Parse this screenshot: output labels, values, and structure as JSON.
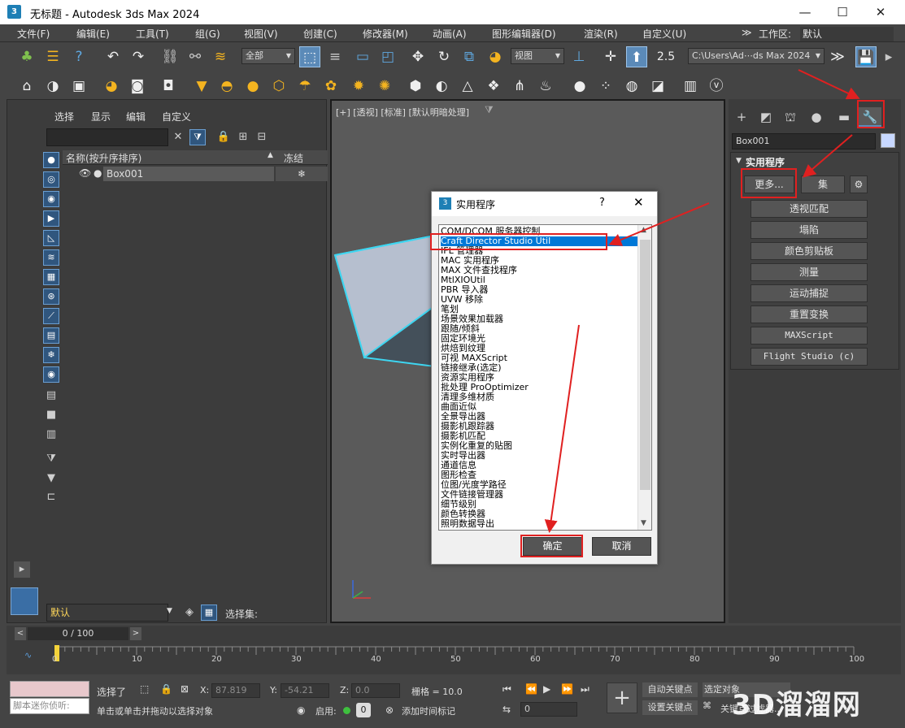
{
  "window": {
    "title": "无标题 - Autodesk 3ds Max 2024",
    "app_icon": "3"
  },
  "menus": [
    "文件(F)",
    "编辑(E)",
    "工具(T)",
    "组(G)",
    "视图(V)",
    "创建(C)",
    "修改器(M)",
    "动画(A)",
    "图形编辑器(D)",
    "渲染(R)",
    "自定义(U)"
  ],
  "workspace": {
    "label": "工作区:",
    "value": "默认"
  },
  "toolbar": {
    "filter_value": "全部",
    "refcoord_value": "视图",
    "path_value": "C:\\Users\\Ad⋯ds Max 2024",
    "snap_value": "2.5"
  },
  "scene_explorer": {
    "tabs": [
      "选择",
      "显示",
      "编辑",
      "自定义"
    ],
    "col_name": "名称(按升序排序)",
    "col_frozen": "冻结",
    "rows": [
      {
        "name": "Box001"
      }
    ],
    "layer_value": "默认",
    "selection_set_label": "选择集:"
  },
  "viewport": {
    "label": "[+] [透视] [标准] [默认明暗处理]"
  },
  "command_panel": {
    "object_name": "Box001",
    "rollout_title": "实用程序",
    "more_label": "更多...",
    "sets_label": "集",
    "utilities": [
      "透视匹配",
      "塌陷",
      "颜色剪贴板",
      "测量",
      "运动捕捉",
      "重置变换",
      "MAXScript",
      "Flight Studio (c)"
    ]
  },
  "dialog": {
    "title": "实用程序",
    "help": "?",
    "items": [
      "COM/DCOM 服务器控制",
      "Craft Director Studio Util",
      "IFL 管理器",
      "MAC 实用程序",
      "MAX 文件查找程序",
      "MtlXIOUtil",
      "PBR 导入器",
      "UVW 移除",
      "笔划",
      "场景效果加载器",
      "跟随/倾斜",
      "固定环境光",
      "烘焙到纹理",
      "可视 MAXScript",
      "链接继承(选定)",
      "资源实用程序",
      "批处理 ProOptimizer",
      "清理多维材质",
      "曲面近似",
      "全景导出器",
      "摄影机跟踪器",
      "摄影机匹配",
      "实例化重复的贴图",
      "实时导出器",
      "通道信息",
      "图形检查",
      "位图/光度学路径",
      "文件链接管理器",
      "细节级别",
      "颜色转换器",
      "照明数据导出"
    ],
    "selected_index": 1,
    "ok_label": "确定",
    "cancel_label": "取消"
  },
  "timeline": {
    "frame_display": "0 / 100",
    "ticks": [
      "0",
      "10",
      "20",
      "30",
      "40",
      "50",
      "60",
      "70",
      "80",
      "90",
      "100"
    ]
  },
  "status": {
    "script_hint": "脚本迷你侦听:",
    "selected_text": "选择了",
    "hint_text": "单击或单击并拖动以选择对象",
    "x_label": "X:",
    "x_value": "87.819",
    "y_label": "Y:",
    "y_value": "-54.21",
    "z_label": "Z:",
    "z_value": "0.0",
    "grid_label": "栅格 = 10.0",
    "enable_label": "启用:",
    "add_time_tag": "添加时间标记",
    "auto_key": "自动关键点",
    "set_key": "设置关键点",
    "selected_obj": "选定对象",
    "key_filter": "关键点过滤器...",
    "frame_value": "0"
  },
  "watermark": "3D溜溜网"
}
